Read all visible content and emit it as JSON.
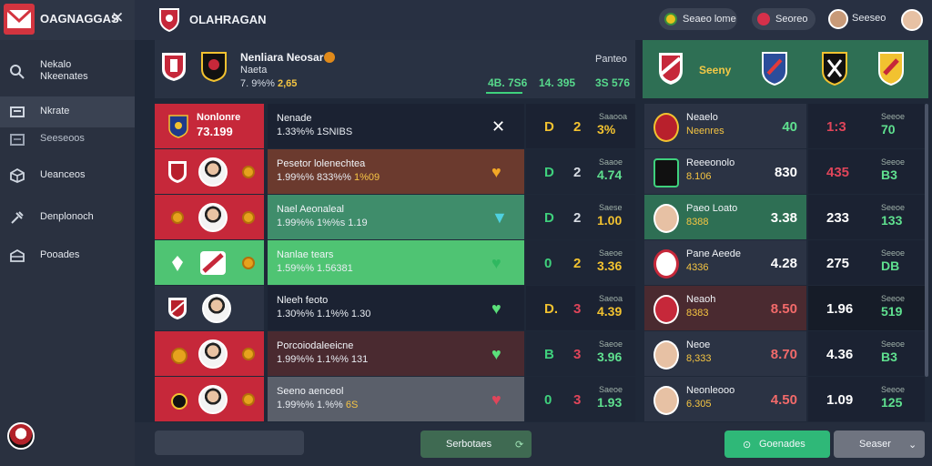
{
  "sidebar": {
    "brand": "OAGNAGGAS",
    "close": "✕",
    "items": [
      {
        "label": "Nekalo Nkeenates",
        "icon": "search-icon"
      },
      {
        "label": "Nkrate",
        "icon": "cart-icon"
      },
      {
        "label": "Seeseoos",
        "icon": "list-icon"
      },
      {
        "label": "Ueanceos",
        "icon": "cube-icon"
      },
      {
        "label": "Denplonoch",
        "icon": "tools-icon"
      },
      {
        "label": "Pooades",
        "icon": "box-icon"
      }
    ]
  },
  "topbar": {
    "title": "OLAHRAGAN",
    "pill1": "Seaeo lome",
    "pill2": "Seoreo",
    "user": "Seeseo"
  },
  "header": {
    "title": "Nenliara Neosar",
    "subtitle": "Naeta",
    "rate_prefix": "7. 9%% ",
    "rate_value": "2,65",
    "label": "Panteo",
    "nums": [
      "4B. 7S6",
      "14. 395",
      "3S 576"
    ],
    "right_label": "Seeny"
  },
  "left_rows": [
    {
      "a_title": "Nonlonre",
      "a_num": "73.199",
      "b_title": "Nenade",
      "b_sub": "1.33%% 1SNIBS",
      "b_hi": "",
      "mark": "✕",
      "d": "D",
      "n": "2",
      "c_lbl": "Saaooa",
      "c_val": "3%"
    },
    {
      "b_title": "Pesetor lolenechtea",
      "b_sub": "1.99%% 833%% ",
      "b_hi": "1%09",
      "mark": "♥",
      "d": "D",
      "n": "2",
      "c_lbl": "Saaoe",
      "c_val": "4.74"
    },
    {
      "b_title": "Nael Aeonaleal",
      "b_sub": "1.99%% 1%%s 1.19",
      "b_hi": "",
      "mark": "▼",
      "d": "D",
      "n": "2",
      "c_lbl": "Saese",
      "c_val": "1.00"
    },
    {
      "b_title": "Nanlae tears",
      "b_sub": "1.59%% 1.56381",
      "b_hi": "",
      "mark": "♥",
      "d": "0",
      "n": "2",
      "c_lbl": "Saeoe",
      "c_val": "3.36"
    },
    {
      "b_title": "Nleeh feoto",
      "b_sub": "1.30%% 1.1%% 1.30",
      "b_hi": "",
      "mark": "♥",
      "d": "D.",
      "n": "3",
      "c_lbl": "Saeoa",
      "c_val": "4.39"
    },
    {
      "b_title": "Porcoiodaleeicne",
      "b_sub": "1.99%% 1.1%% 131",
      "b_hi": "",
      "mark": "♥",
      "d": "B",
      "n": "3",
      "c_lbl": "Saeoe",
      "c_val": "3.96"
    },
    {
      "b_title": "Seeno aenceol",
      "b_sub": "1.99%% 1.%% ",
      "b_hi": "6S",
      "mark": "♥",
      "d": "0",
      "n": "3",
      "c_lbl": "Saeoe",
      "c_val": "1.93"
    }
  ],
  "right_rows": [
    {
      "title": "Neaelo",
      "sub": "Neenres",
      "val": "40",
      "e_val": "1:3",
      "e_lbl": "Seeoe",
      "e_val2": "70"
    },
    {
      "title": "Reeeonolo",
      "sub": "8.106",
      "val": "830",
      "e_val": "435",
      "e_lbl": "Seeoe",
      "e_val2": "B3"
    },
    {
      "title": "Paeo Loato",
      "sub": "8388",
      "val": "3.38",
      "e_val": "233",
      "e_lbl": "Seeoe",
      "e_val2": "133"
    },
    {
      "title": "Pane Aeede",
      "sub": "4336",
      "val": "4.28",
      "e_val": "275",
      "e_lbl": "Seeoe",
      "e_val2": "DB"
    },
    {
      "title": "Neaoh",
      "sub": "8383",
      "val": "8.50",
      "e_val": "1.96",
      "e_lbl": "Seeoe",
      "e_val2": "519"
    },
    {
      "title": "Neoe",
      "sub": "8,333",
      "val": "8.70",
      "e_val": "4.36",
      "e_lbl": "Seeoe",
      "e_val2": "B3"
    },
    {
      "title": "Neonleooo",
      "sub": "6.305",
      "val": "4.50",
      "e_val": "1.09",
      "e_lbl": "Seeoe",
      "e_val2": "125"
    }
  ],
  "footer": {
    "btn1": "Serbotaes",
    "btn2": "Goenades",
    "select": "Seaser"
  },
  "colors": {
    "red": "#c6283a",
    "green": "#3f8d6b",
    "bright_green": "#4fc473",
    "brown": "#6b3a2e",
    "gold": "#f5c542"
  }
}
